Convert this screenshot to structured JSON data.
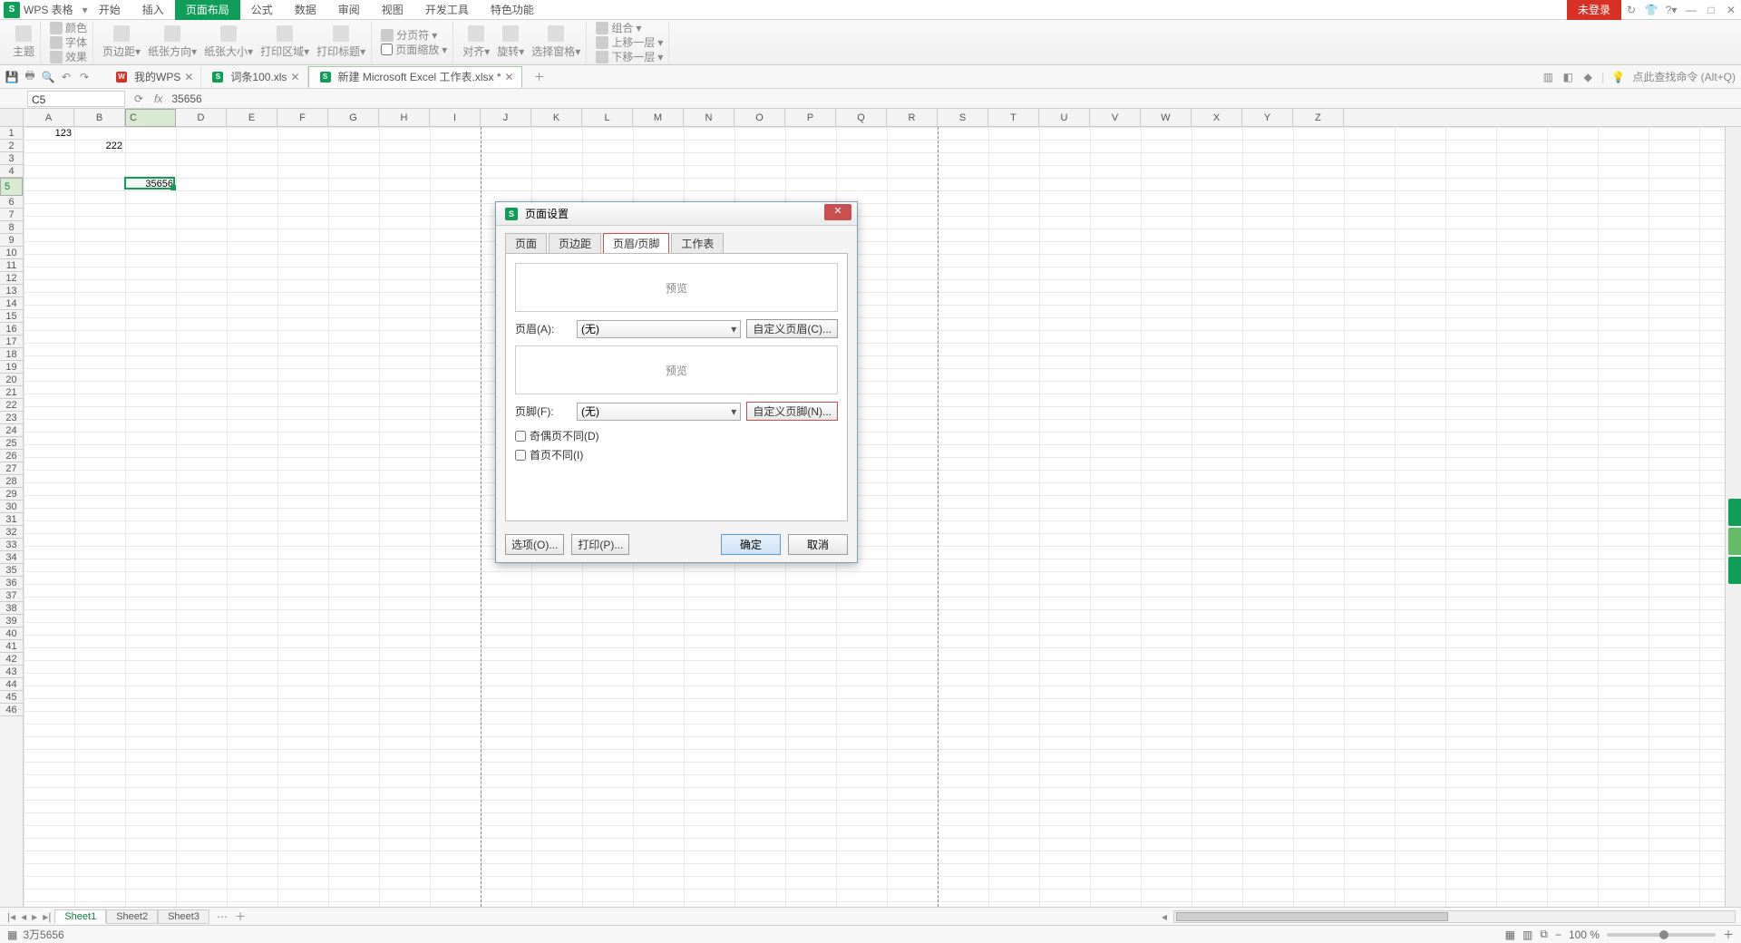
{
  "app": {
    "logo": "S",
    "name": "WPS 表格"
  },
  "menus": [
    "开始",
    "插入",
    "页面布局",
    "公式",
    "数据",
    "审阅",
    "视图",
    "开发工具",
    "特色功能"
  ],
  "menu_active_index": 2,
  "title_right": {
    "unlogged": "未登录"
  },
  "ribbon": {
    "r1": {
      "a": "颜色",
      "b": "字体",
      "c": "效果"
    },
    "theme": "主题",
    "g2": [
      "页边距",
      "纸张方向",
      "纸张大小",
      "打印区域",
      "打印标题",
      "页面缩放"
    ],
    "g2_top": {
      "a": "分页符"
    },
    "g3": [
      "对齐",
      "旋转",
      "选择窗格"
    ],
    "g3_top": {
      "a": "组合",
      "b": "上移一层",
      "c": "下移一层"
    }
  },
  "doc_tabs": [
    {
      "icon": "W",
      "label": "我的WPS"
    },
    {
      "icon": "S",
      "label": "词条100.xls"
    },
    {
      "icon": "S",
      "label": "新建 Microsoft Excel 工作表.xlsx *",
      "active": true
    }
  ],
  "search_hint": "点此查找命令 (Alt+Q)",
  "namebox": "C5",
  "formula_value": "35656",
  "cols": [
    "A",
    "B",
    "C",
    "D",
    "E",
    "F",
    "G",
    "H",
    "I",
    "J",
    "K",
    "L",
    "M",
    "N",
    "O",
    "P",
    "Q",
    "R",
    "S",
    "T",
    "U",
    "V",
    "W",
    "X",
    "Y",
    "Z"
  ],
  "rows_count": 46,
  "cells": [
    {
      "col": 0,
      "row": 0,
      "val": "123"
    },
    {
      "col": 1,
      "row": 1,
      "val": "222"
    },
    {
      "col": 2,
      "row": 4,
      "val": "35656"
    }
  ],
  "selected": {
    "col": 2,
    "row": 4
  },
  "page_breaks_cols": [
    9,
    18
  ],
  "sheets": [
    "Sheet1",
    "Sheet2",
    "Sheet3"
  ],
  "sheet_active": 0,
  "status": {
    "text": "3万5656",
    "zoom": "100 %"
  },
  "dialog": {
    "title": "页面设置",
    "tabs": [
      "页面",
      "页边距",
      "页眉/页脚",
      "工作表"
    ],
    "tab_active": 2,
    "preview": "预览",
    "header_label": "页眉(A):",
    "header_value": "(无)",
    "header_custom": "自定义页眉(C)...",
    "footer_label": "页脚(F):",
    "footer_value": "(无)",
    "footer_custom": "自定义页脚(N)...",
    "chk1": "奇偶页不同(D)",
    "chk2": "首页不同(I)",
    "options": "选项(O)...",
    "print": "打印(P)...",
    "ok": "确定",
    "cancel": "取消"
  }
}
